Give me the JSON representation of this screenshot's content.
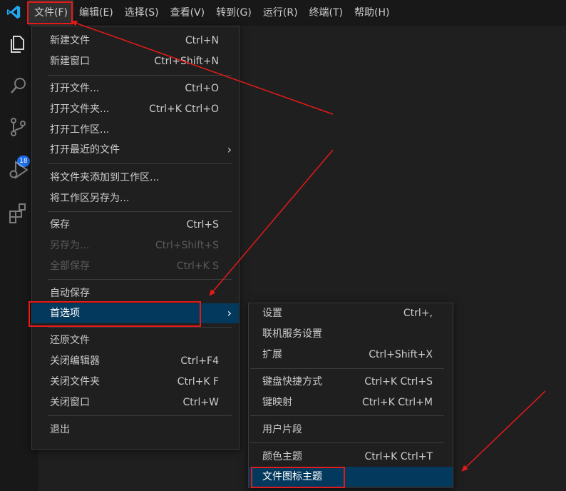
{
  "menubar": [
    {
      "label": "文件(F)",
      "open": true
    },
    {
      "label": "编辑(E)"
    },
    {
      "label": "选择(S)"
    },
    {
      "label": "查看(V)"
    },
    {
      "label": "转到(G)"
    },
    {
      "label": "运行(R)"
    },
    {
      "label": "终端(T)"
    },
    {
      "label": "帮助(H)"
    }
  ],
  "activitybar": {
    "source_control_badge": "18"
  },
  "file_menu": {
    "items": [
      {
        "label": "新建文件",
        "shortcut": "Ctrl+N"
      },
      {
        "label": "新建窗口",
        "shortcut": "Ctrl+Shift+N"
      },
      {
        "label": "打开文件...",
        "shortcut": "Ctrl+O"
      },
      {
        "label": "打开文件夹...",
        "shortcut": "Ctrl+K Ctrl+O"
      },
      {
        "label": "打开工作区...",
        "shortcut": ""
      },
      {
        "label": "打开最近的文件",
        "shortcut": "",
        "submenu": true
      },
      {
        "label": "将文件夹添加到工作区...",
        "shortcut": ""
      },
      {
        "label": "将工作区另存为...",
        "shortcut": ""
      },
      {
        "label": "保存",
        "shortcut": "Ctrl+S"
      },
      {
        "label": "另存为...",
        "shortcut": "Ctrl+Shift+S",
        "disabled": true
      },
      {
        "label": "全部保存",
        "shortcut": "Ctrl+K S",
        "disabled": true
      },
      {
        "label": "自动保存",
        "shortcut": ""
      },
      {
        "label": "首选项",
        "shortcut": "",
        "submenu": true,
        "selected": true
      },
      {
        "label": "还原文件",
        "shortcut": ""
      },
      {
        "label": "关闭编辑器",
        "shortcut": "Ctrl+F4"
      },
      {
        "label": "关闭文件夹",
        "shortcut": "Ctrl+K F"
      },
      {
        "label": "关闭窗口",
        "shortcut": "Ctrl+W"
      },
      {
        "label": "退出",
        "shortcut": ""
      }
    ]
  },
  "preferences_menu": {
    "items": [
      {
        "label": "设置",
        "shortcut": "Ctrl+,"
      },
      {
        "label": "联机服务设置",
        "shortcut": ""
      },
      {
        "label": "扩展",
        "shortcut": "Ctrl+Shift+X"
      },
      {
        "label": "键盘快捷方式",
        "shortcut": "Ctrl+K Ctrl+S"
      },
      {
        "label": "键映射",
        "shortcut": "Ctrl+K Ctrl+M"
      },
      {
        "label": "用户片段",
        "shortcut": ""
      },
      {
        "label": "颜色主题",
        "shortcut": "Ctrl+K Ctrl+T"
      },
      {
        "label": "文件图标主题",
        "shortcut": "",
        "selected": true
      }
    ]
  },
  "colors": {
    "background": "#1e1e1e",
    "menu_background": "#1f1f1f",
    "selection": "#04395e",
    "annotation": "#e31a1a",
    "logo": "#23a9f2"
  }
}
